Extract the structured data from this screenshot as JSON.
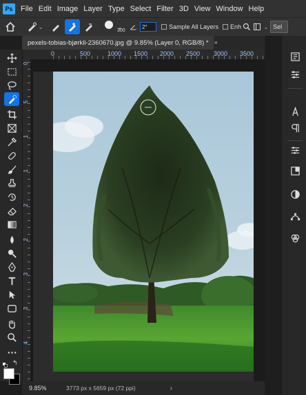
{
  "menu": {
    "items": [
      "File",
      "Edit",
      "Image",
      "Layer",
      "Type",
      "Select",
      "Filter",
      "3D",
      "View",
      "Window",
      "Help"
    ]
  },
  "logo": {
    "text": "Ps"
  },
  "options_bar": {
    "brush_size": "300",
    "angle_value": "2°",
    "sample_all_layers_label": "Sample All Layers",
    "enhance_label": "Enh",
    "select_subject_label": "Sel"
  },
  "document": {
    "tab_title": "pexels-tobias-bjørkli-2360670.jpg @ 9.85% (Layer 0, RGB/8) *",
    "close_glyph": "×"
  },
  "ruler": {
    "top_labels": [
      "0",
      "500",
      "1000",
      "1500",
      "2000",
      "2500",
      "3000",
      "3500"
    ],
    "left_labels": [
      "0",
      "5",
      "1",
      "1",
      "2",
      "2",
      "3",
      "3",
      "4"
    ]
  },
  "status": {
    "zoom": "9.85%",
    "doc_size": "3773 px x 5659 px (72 ppi)",
    "arrow": "›"
  },
  "colors": {
    "accent": "#1473e6",
    "foreground": "#ffffff",
    "background": "#000000"
  },
  "tools": [
    "move-tool",
    "marquee-tool",
    "lasso-tool",
    "quick-selection-tool",
    "crop-tool",
    "frame-tool",
    "eyedropper-tool",
    "healing-brush-tool",
    "brush-tool",
    "clone-stamp-tool",
    "history-brush-tool",
    "eraser-tool",
    "gradient-tool",
    "blur-tool",
    "dodge-tool",
    "pen-tool",
    "type-tool",
    "path-selection-tool",
    "rectangle-tool",
    "hand-tool",
    "zoom-tool",
    "more-tools"
  ],
  "panels": [
    "history-panel",
    "properties-panel",
    "character-panel",
    "paragraph-panel",
    "adjustments-panel",
    "libraries-panel",
    "layers-panel",
    "paths-panel",
    "channels-panel"
  ]
}
